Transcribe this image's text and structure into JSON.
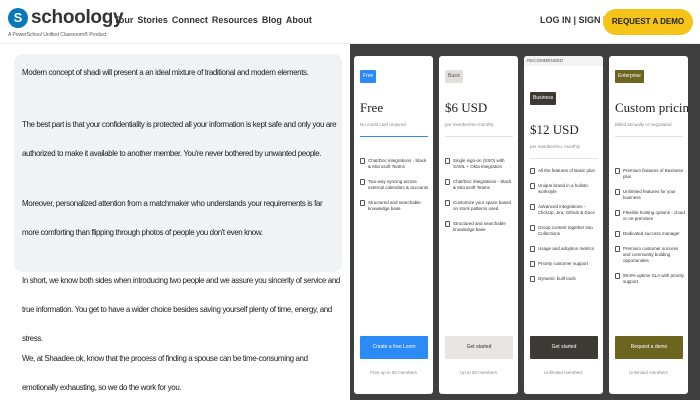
{
  "header": {
    "logo_letter": "S",
    "logo_word": "schoology",
    "logo_tag": "A PowerSchool Unified Classroom® Product",
    "nav": [
      "Tour",
      "Stories",
      "Connect",
      "Resources",
      "Blog",
      "About"
    ],
    "login": "LOG IN | SIGN UP",
    "demo": "REQUEST A DEMO",
    "demo_color": "#f6c419"
  },
  "article": {
    "paragraphs": [
      "Modern concept of shadi will present a an ideal mixture of traditional and modern elements.",
      "The best part is that your confidentiality is protected all your information is kept safe and only you are authorized to make it available to another member. You're never bothered by unwanted people.",
      "Moreover, personalized attention from a matchmaker who understands your requirements is far more comforting than flipping through photos of people you don't even know.",
      "In short, we know both sides when introducing two people and we assure you sincerity of service and true information. You get to have a wider choice besides saving yourself plenty of time, energy, and stress.",
      "We, at Shaadee.ok, know that the process of finding a spouse can be time-consuming and emotionally exhausting, so we do the work for you."
    ]
  },
  "pricing": {
    "plans": [
      {
        "badge": "Free",
        "name": "Free",
        "sub": "No credit card required",
        "features": [
          "Chat/Doc integrations - Slack & Microsoft Teams",
          "Two-way syncing across external calendars & accounts",
          "Structured and searchable knowledge base"
        ],
        "cta": "Create a free Loom",
        "foot": "Free up to 50 members",
        "accent": "#2a8af6",
        "cta_text_color": "#ffffff"
      },
      {
        "badge": "Basic",
        "name": "$6 USD",
        "sub": "per member/mo monthly",
        "features": [
          "Single sign-on (SSO) with SAML + Okta integration",
          "Chat/Doc integrations - Slack & Microsoft Teams",
          "Customize your space based on stock patterns used",
          "Structured and searchable knowledge base"
        ],
        "cta": "Get started",
        "foot": "Up to 50 members",
        "accent": "#e8e6e3",
        "cta_text_color": "#333333"
      },
      {
        "top_label": "RECOMMENDED",
        "badge": "Business",
        "name": "$12 USD",
        "sub": "per member/mo, monthly",
        "features": [
          "All the features of Basic plus",
          "Unique brand in a holistic workstyle",
          "Advanced integrations - ClickUp, Jira, Github & Docs",
          "Group content together into Collections",
          "Usage and adoption metrics",
          "Priority customer support",
          "Dynamic built tools"
        ],
        "cta": "Get started",
        "foot": "Unlimited members",
        "accent": "#3d3a36",
        "cta_text_color": "#ffffff"
      },
      {
        "badge": "Enterprise",
        "name": "Custom pricing",
        "sub": "Billed annually or negotiated",
        "features": [
          "Premium features of Business plus",
          "Unlimited features for your business",
          "Flexible hosting options - cloud or on-premises",
          "Dedicated success manager",
          "Premium customer success and community building opportunities",
          "99.9% uptime SLA with priority support"
        ],
        "cta": "Request a demo",
        "foot": "Unlimited members",
        "accent": "#6b6520",
        "cta_text_color": "#ffffff"
      }
    ]
  }
}
